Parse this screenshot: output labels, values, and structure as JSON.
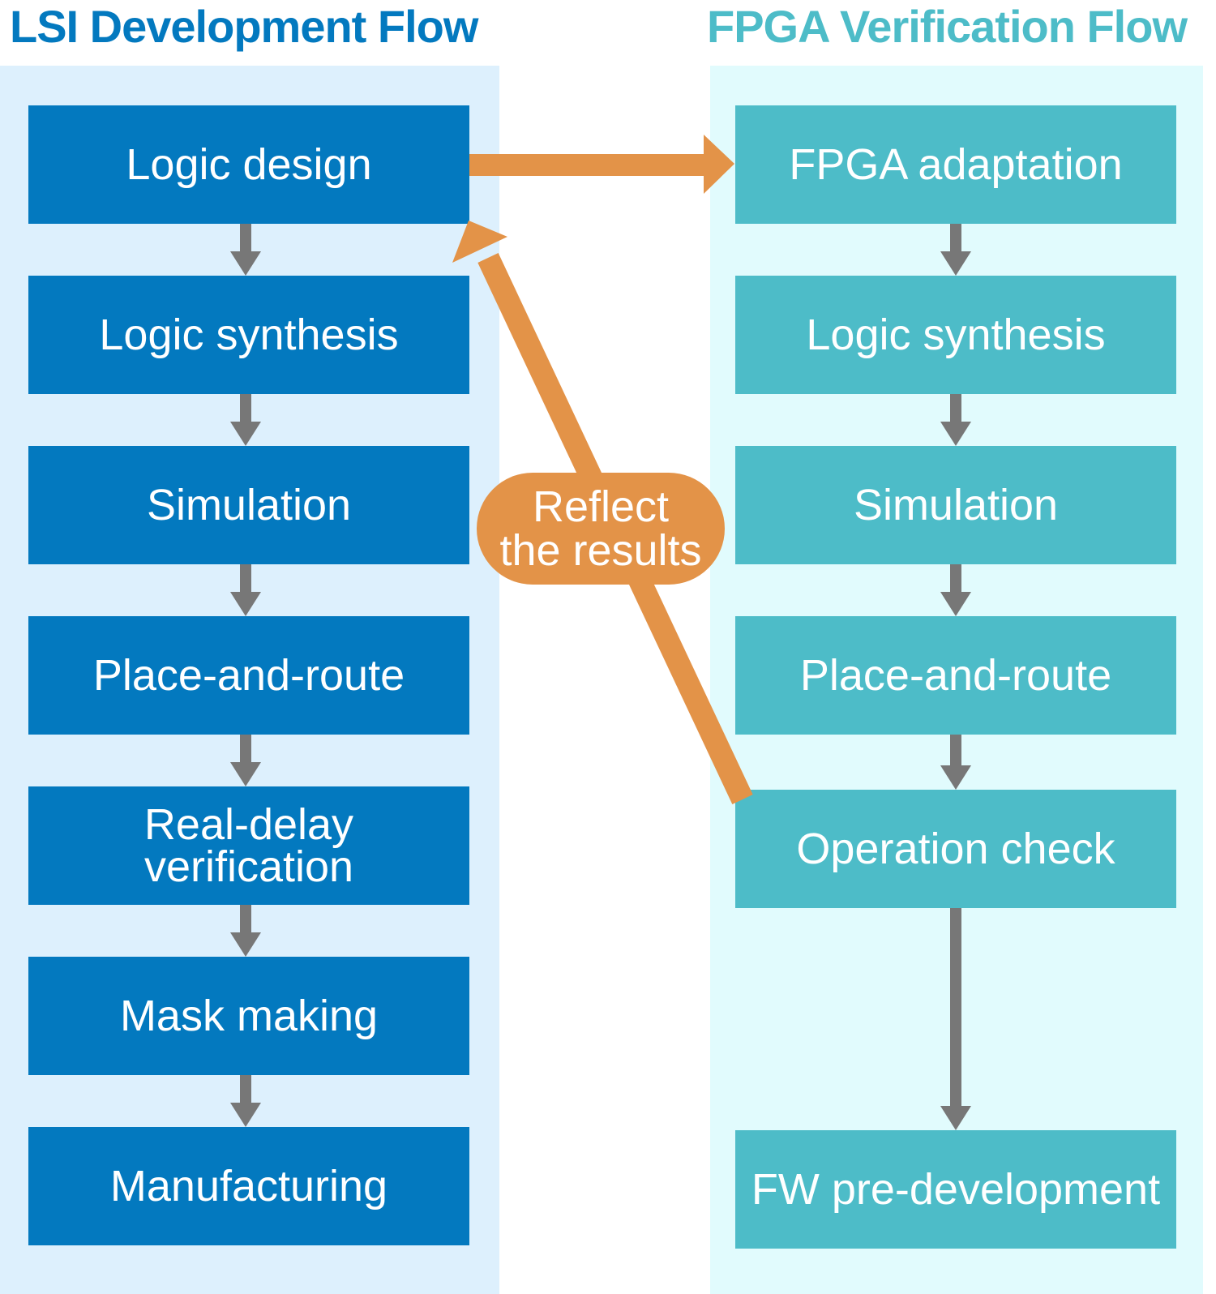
{
  "titles": {
    "left": "LSI Development Flow",
    "right": "FPGA Verification Flow"
  },
  "lsi_flow": {
    "steps": [
      {
        "label": "Logic design"
      },
      {
        "label": "Logic synthesis"
      },
      {
        "label": "Simulation"
      },
      {
        "label": "Place-and-route"
      },
      {
        "label": "Real-delay\nverification"
      },
      {
        "label": "Mask making"
      },
      {
        "label": "Manufacturing"
      }
    ]
  },
  "fpga_flow": {
    "steps": [
      {
        "label": "FPGA adaptation"
      },
      {
        "label": "Logic synthesis"
      },
      {
        "label": "Simulation"
      },
      {
        "label": "Place-and-route"
      },
      {
        "label": "Operation check"
      },
      {
        "label": "FW pre-development"
      }
    ]
  },
  "feedback": {
    "label": "Reflect\nthe results"
  },
  "colors": {
    "lsi_box": "#0379bf",
    "fpga_box": "#4dbcc8",
    "lsi_lane": "#ddf0fd",
    "fpga_lane": "#e1fbfd",
    "accent_arrow": "#e39348",
    "flow_arrow": "#777777"
  }
}
